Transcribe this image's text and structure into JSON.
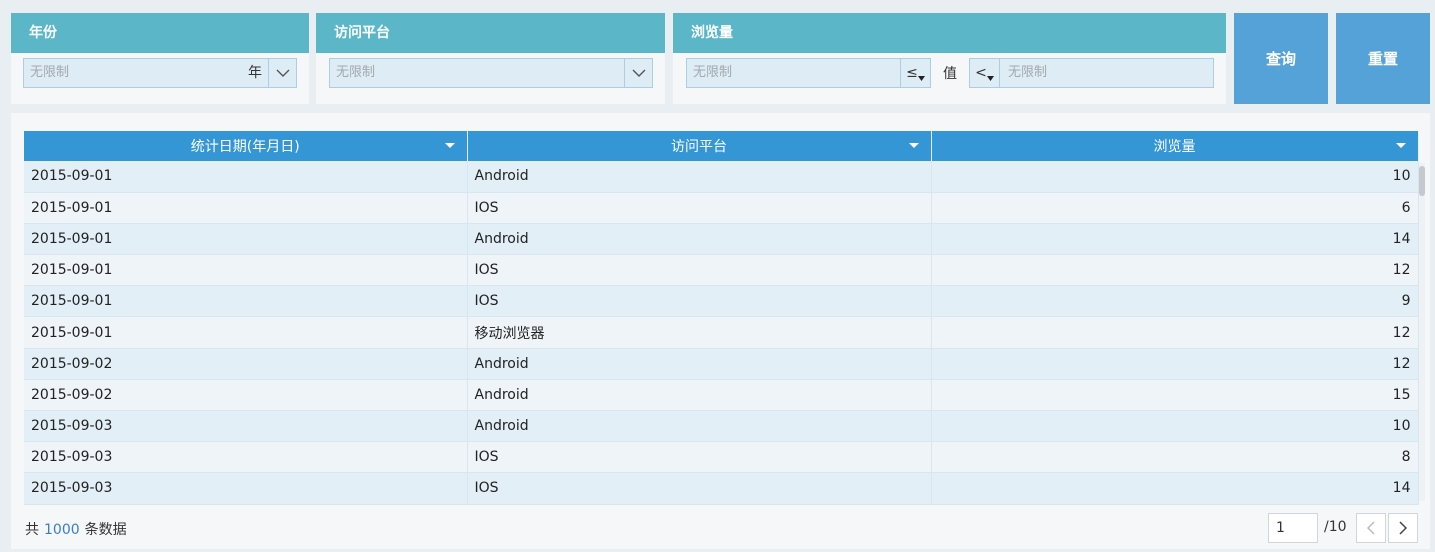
{
  "filters": {
    "year": {
      "title": "年份",
      "placeholder": "无限制",
      "suffix": "年"
    },
    "platform": {
      "title": "访问平台",
      "placeholder": "无限制"
    },
    "views": {
      "title": "浏览量",
      "min_placeholder": "无限制",
      "min_operator": "≤",
      "value_label": "值",
      "max_operator": "<",
      "max_placeholder": "无限制"
    }
  },
  "buttons": {
    "query": "查询",
    "reset": "重置"
  },
  "table": {
    "columns": [
      "统计日期(年月日)",
      "访问平台",
      "浏览量"
    ],
    "rows": [
      [
        "2015-09-01",
        "Android",
        "10"
      ],
      [
        "2015-09-01",
        "IOS",
        "6"
      ],
      [
        "2015-09-01",
        "Android",
        "14"
      ],
      [
        "2015-09-01",
        "IOS",
        "12"
      ],
      [
        "2015-09-01",
        "IOS",
        "9"
      ],
      [
        "2015-09-01",
        "移动浏览器",
        "12"
      ],
      [
        "2015-09-02",
        "Android",
        "12"
      ],
      [
        "2015-09-02",
        "Android",
        "15"
      ],
      [
        "2015-09-03",
        "Android",
        "10"
      ],
      [
        "2015-09-03",
        "IOS",
        "8"
      ],
      [
        "2015-09-03",
        "IOS",
        "14"
      ]
    ]
  },
  "footer": {
    "total_prefix": "共",
    "total_count": "1000",
    "total_suffix": "条数据",
    "current_page": "1",
    "total_pages": "/10"
  },
  "colors": {
    "panel_header": "#5bb7c8",
    "table_header": "#3496d4",
    "button": "#55a2d8"
  }
}
